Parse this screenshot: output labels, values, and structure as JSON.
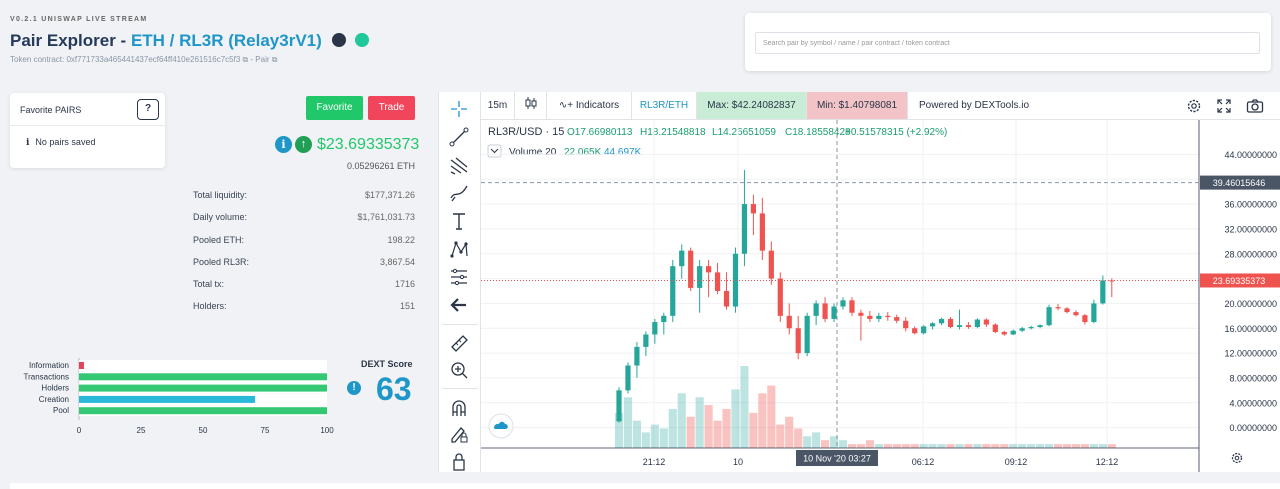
{
  "header": {
    "version": "V0.2.1 UNISWAP LIVE STREAM",
    "title_prefix": "Pair Explorer - ",
    "pair": "ETH / RL3R (Relay3rV1)",
    "token_contract": "Token contract: 0xf771733a465441437ecf64ff410e261516c7c5f3 ⧉ - Pair ⧉"
  },
  "search": {
    "placeholder": "Search pair by symbol / name / pair contract / token contract"
  },
  "favorites": {
    "title": "Favorite PAIRS",
    "help": "?",
    "empty_icon": "i",
    "empty_text": "No pairs saved"
  },
  "actions": {
    "favorite": "Favorite",
    "trade": "Trade"
  },
  "price": {
    "usd": "$23.69335373",
    "eth": "0.05296261 ETH",
    "info_icon": "i",
    "up_icon": "↑"
  },
  "stats": [
    {
      "label": "Total liquidity:",
      "value": "$177,371.26"
    },
    {
      "label": "Daily volume:",
      "value": "$1,761,031.73"
    },
    {
      "label": "Pooled ETH:",
      "value": "198.22"
    },
    {
      "label": "Pooled RL3R:",
      "value": "3,867.54"
    },
    {
      "label": "Total tx:",
      "value": "1716"
    },
    {
      "label": "Holders:",
      "value": "151"
    }
  ],
  "dext": {
    "label": "DEXT Score",
    "score": "63",
    "warn_icon": "!"
  },
  "chart_data": [
    {
      "type": "bar",
      "orientation": "horizontal",
      "categories": [
        "Information",
        "Transactions",
        "Holders",
        "Creation",
        "Pool"
      ],
      "values": [
        2,
        100,
        100,
        71,
        100
      ],
      "colors": [
        "#e0455a",
        "#34c874",
        "#34c874",
        "#2ab8d8",
        "#34c874"
      ],
      "xlim": [
        0,
        100
      ],
      "xticks": [
        "0",
        "25",
        "50",
        "75",
        "100"
      ]
    },
    {
      "type": "candlestick",
      "title": "RL3R/USD · 15",
      "ohlc_labels": {
        "o": "O17.66980113",
        "h": "H18.21548818",
        "l": "L14.26651059",
        "c": "C18.18558428",
        "chg": "+0.51578315 (+2.92%)"
      },
      "volume_label": "Volume 20",
      "volume_values": [
        "22.065K",
        "44.697K"
      ],
      "y_axis_ticks": [
        "44.00000000",
        "40.00000000",
        "36.00000000",
        "32.00000000",
        "28.00000000",
        "24.00000000",
        "20.00000000",
        "16.00000000",
        "12.00000000",
        "8.00000000",
        "4.00000000",
        "0.00000000"
      ],
      "ylim": [
        -2,
        46
      ],
      "x_axis_ticks": [
        "21:12",
        "10",
        "06:12",
        "09:12",
        "12:12"
      ],
      "crosshair_price": "39.46015646",
      "crosshair_time": "10 Nov '20   03:27",
      "last_price": "23.69335373",
      "candles": [
        [
          1.0,
          6.5,
          0.8,
          6.0
        ],
        [
          6.0,
          10.5,
          5.5,
          10.0
        ],
        [
          10.0,
          13.8,
          8.0,
          13.0
        ],
        [
          13.0,
          15.5,
          11.5,
          15.0
        ],
        [
          15.0,
          17.5,
          13.5,
          17.0
        ],
        [
          17.0,
          18.5,
          15.0,
          18.0
        ],
        [
          18.0,
          27.0,
          17.0,
          26.0
        ],
        [
          26.0,
          29.5,
          24.0,
          28.5
        ],
        [
          28.5,
          29.0,
          22.0,
          22.5
        ],
        [
          22.5,
          27.0,
          18.5,
          26.0
        ],
        [
          26.0,
          27.0,
          21.0,
          25.0
        ],
        [
          25.0,
          26.5,
          21.5,
          22.0
        ],
        [
          22.0,
          25.0,
          19.0,
          19.5
        ],
        [
          19.5,
          29.0,
          18.5,
          28.0
        ],
        [
          28.0,
          41.5,
          26.0,
          36.0
        ],
        [
          36.0,
          37.5,
          31.0,
          34.5
        ],
        [
          34.5,
          37.0,
          27.0,
          28.5
        ],
        [
          28.5,
          30.0,
          23.0,
          24.0
        ],
        [
          24.0,
          25.0,
          17.0,
          18.0
        ],
        [
          18.0,
          20.0,
          15.0,
          16.0
        ],
        [
          16.0,
          18.0,
          11.0,
          12.0
        ],
        [
          12.0,
          18.5,
          11.5,
          18.0
        ],
        [
          18.0,
          20.5,
          16.5,
          20.0
        ],
        [
          20.0,
          21.0,
          17.0,
          17.5
        ],
        [
          17.5,
          20.0,
          17.0,
          19.5
        ],
        [
          19.5,
          21.0,
          19.0,
          20.5
        ],
        [
          20.5,
          21.0,
          18.0,
          18.5
        ],
        [
          18.5,
          19.0,
          14.0,
          18.0
        ],
        [
          18.0,
          18.8,
          17.0,
          17.5
        ],
        [
          17.5,
          18.5,
          17.0,
          18.0
        ],
        [
          18.0,
          18.6,
          17.2,
          17.8
        ],
        [
          17.8,
          18.2,
          16.8,
          17.2
        ],
        [
          17.2,
          17.8,
          15.5,
          16.0
        ],
        [
          16.0,
          16.3,
          15.0,
          15.2
        ],
        [
          15.2,
          16.5,
          15.0,
          16.3
        ],
        [
          16.3,
          17.0,
          15.8,
          16.8
        ],
        [
          16.8,
          17.7,
          16.5,
          17.5
        ],
        [
          17.5,
          17.8,
          16.0,
          16.2
        ],
        [
          16.2,
          19.0,
          15.8,
          16.5
        ],
        [
          16.5,
          17.0,
          15.9,
          16.2
        ],
        [
          16.2,
          17.6,
          16.0,
          17.4
        ],
        [
          17.4,
          17.6,
          16.2,
          16.6
        ],
        [
          16.6,
          16.8,
          15.2,
          15.4
        ],
        [
          15.4,
          15.6,
          14.8,
          15.0
        ],
        [
          15.0,
          15.8,
          14.9,
          15.6
        ],
        [
          15.6,
          16.2,
          15.4,
          16.0
        ],
        [
          16.0,
          16.4,
          15.8,
          16.2
        ],
        [
          16.2,
          16.6,
          16.0,
          16.5
        ],
        [
          16.5,
          19.8,
          16.3,
          19.4
        ],
        [
          19.4,
          19.9,
          18.9,
          19.2
        ],
        [
          19.2,
          19.4,
          18.4,
          18.6
        ],
        [
          18.6,
          18.9,
          17.9,
          18.1
        ],
        [
          18.1,
          18.3,
          16.6,
          17.0
        ],
        [
          17.0,
          20.6,
          16.8,
          20.0
        ],
        [
          20.0,
          24.5,
          19.8,
          23.7
        ],
        [
          23.7,
          24.0,
          21.0,
          23.69
        ]
      ],
      "volumes": [
        9,
        13,
        7,
        4,
        6,
        5,
        10,
        14,
        8,
        13,
        11,
        7,
        10,
        15,
        21,
        9,
        14,
        16,
        6,
        8,
        5,
        3,
        4,
        2,
        3,
        2,
        1,
        1,
        2,
        1,
        1,
        1,
        1,
        1,
        1,
        1,
        1,
        1,
        1,
        1,
        1,
        1,
        1,
        1,
        1,
        1,
        1,
        1,
        1,
        1,
        1,
        1,
        1,
        1,
        1,
        1
      ]
    }
  ],
  "topbar": {
    "interval": "15m",
    "indicators": "Indicators",
    "pair": "RL3R/ETH",
    "max": "Max: $42.24082837",
    "min": "Min: $1.40798081",
    "powered": "Powered by DEXTools.io"
  }
}
